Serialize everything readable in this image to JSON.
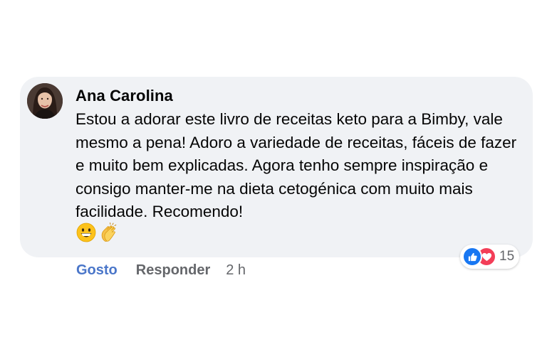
{
  "comment": {
    "author": "Ana Carolina",
    "text": "Estou a adorar este livro de receitas keto para a Bimby, vale mesmo a pena! Adoro a variedade de receitas, fáceis de fazer e muito bem explicadas. Agora tenho sempre inspiração e consigo manter-me na dieta cetogénica com muito mais facilidade. Recomendo!",
    "emojis": [
      "grinning-face-emoji",
      "clapping-hands-emoji"
    ],
    "reactions": {
      "icons": [
        "like-icon",
        "love-icon"
      ],
      "count": "15"
    }
  },
  "actions": {
    "like_label": "Gosto",
    "reply_label": "Responder",
    "time": "2 h"
  },
  "colors": {
    "bubble": "#f0f2f5",
    "like_link": "#4a76c9",
    "secondary_text": "#65676b",
    "like_reaction": "#1877f2",
    "love_reaction": "#f33e58"
  }
}
